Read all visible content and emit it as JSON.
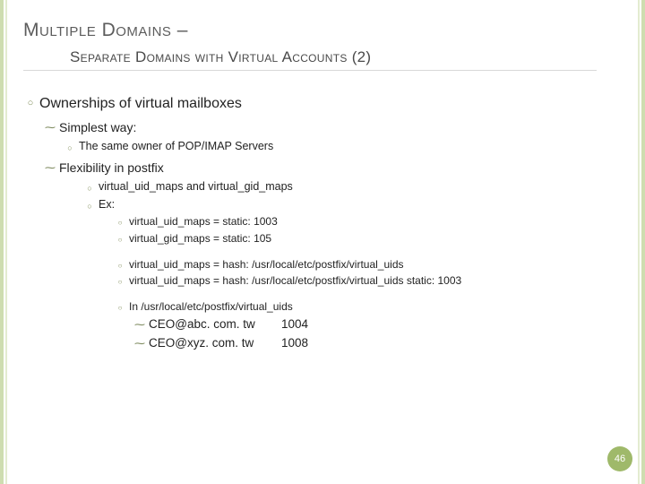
{
  "title": {
    "line1_main": "Multiple Domains",
    "line1_dash": " –",
    "line2": "Separate Domains with Virtual Accounts",
    "line2_paren": "(2)"
  },
  "l1": "Ownerships of virtual mailboxes",
  "simplest": {
    "label": "Simplest way:",
    "sub": "The same owner of POP/IMAP Servers"
  },
  "flex": {
    "label": "Flexibility in postfix",
    "maps": "virtual_uid_maps and virtual_gid_maps",
    "ex": "Ex:",
    "block1a": "virtual_uid_maps = static: 1003",
    "block1b": "virtual_gid_maps = static: 105",
    "block2a": "virtual_uid_maps = hash: /usr/local/etc/postfix/virtual_uids",
    "block2b": "virtual_uid_maps = hash: /usr/local/etc/postfix/virtual_uids   static: 1003",
    "block3": "In /usr/local/etc/postfix/virtual_uids",
    "email1_addr": "CEO@abc. com. tw",
    "email1_id": "1004",
    "email2_addr": "CEO@xyz. com. tw",
    "email2_id": "1008"
  },
  "page": "46"
}
